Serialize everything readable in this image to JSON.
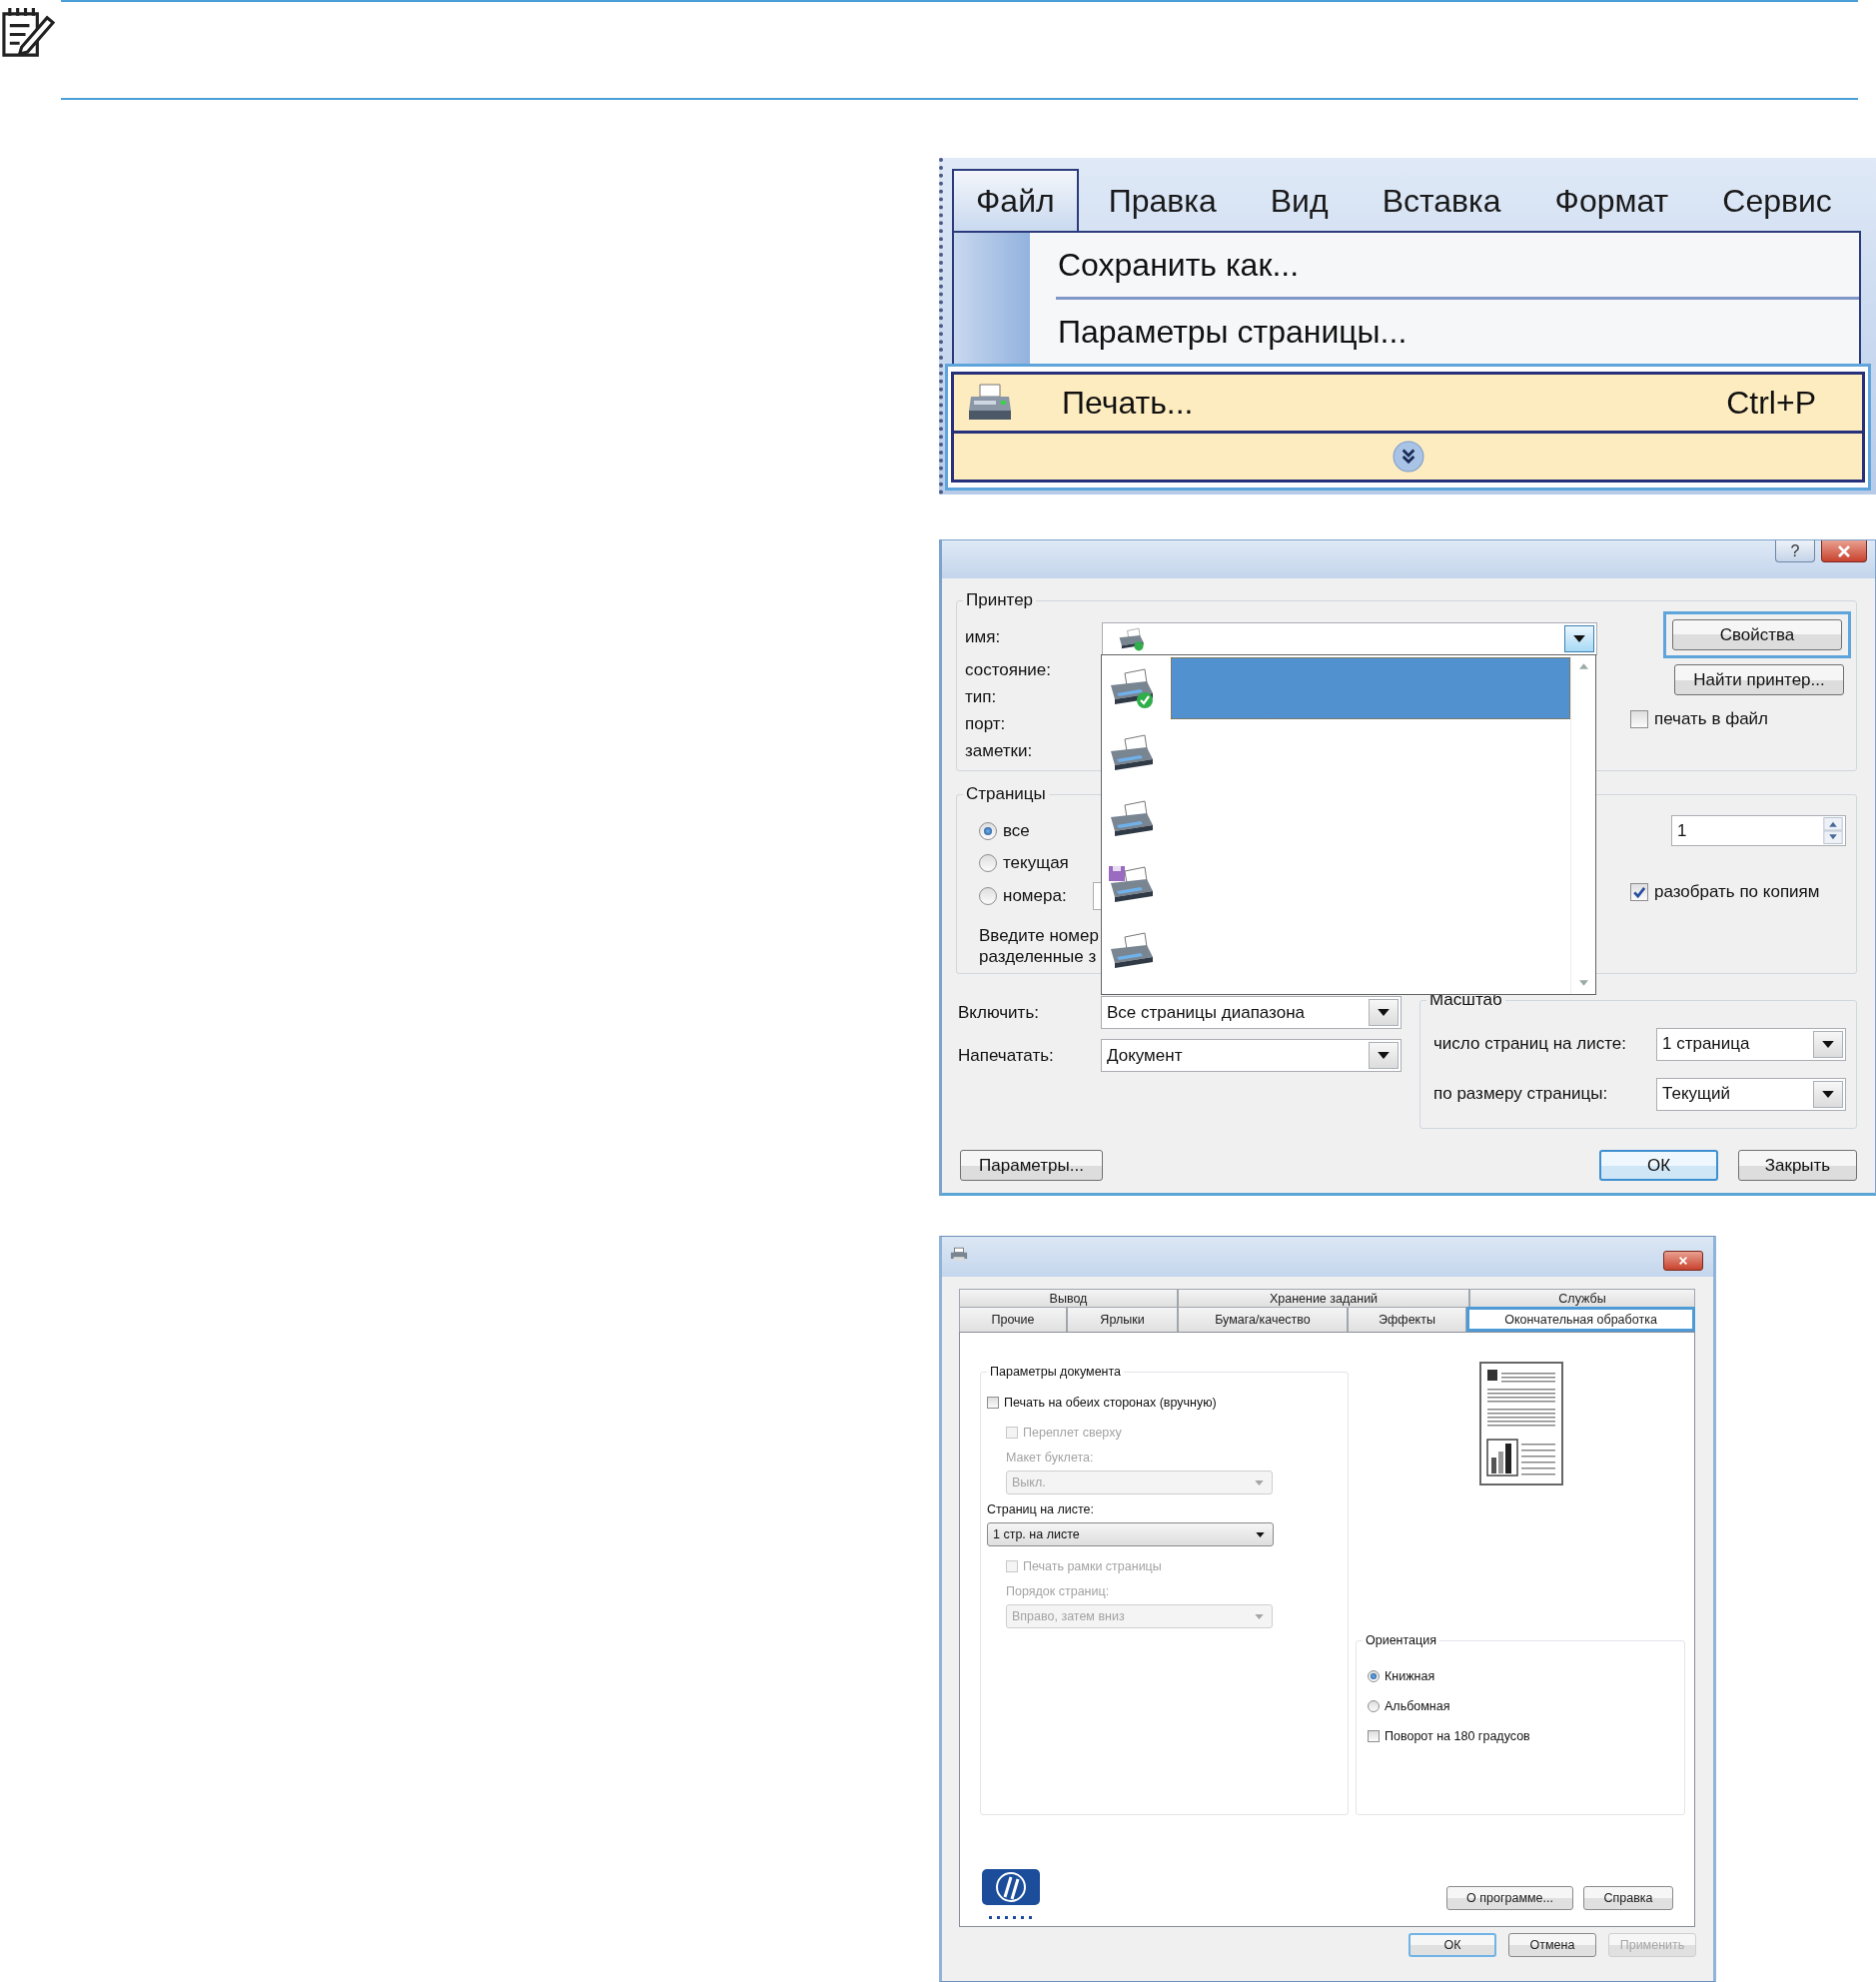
{
  "menu": {
    "menubar": [
      {
        "label": "Файл",
        "selected": true
      },
      {
        "label": "Правка",
        "selected": false
      },
      {
        "label": "Вид",
        "selected": false
      },
      {
        "label": "Вставка",
        "selected": false
      },
      {
        "label": "Формат",
        "selected": false
      },
      {
        "label": "Сервис",
        "selected": false
      }
    ],
    "items": [
      {
        "kind": "command",
        "label": "Сохранить как...",
        "highlighted": false
      },
      {
        "kind": "command",
        "label": "Параметры страницы...",
        "highlighted": false
      },
      {
        "kind": "print",
        "label": "Печать...",
        "shortcut": "Ctrl+P",
        "highlighted": true
      },
      {
        "kind": "expand",
        "highlighted": true
      }
    ]
  },
  "print_dialog": {
    "help_glyph": "?",
    "printer": {
      "title": "Принтер",
      "labels": [
        "имя:",
        "состояние:",
        "тип:",
        "порт:",
        "заметки:"
      ],
      "list": [
        {
          "kind": "default",
          "selected": true
        },
        {
          "kind": "printer",
          "selected": false
        },
        {
          "kind": "printer",
          "selected": false
        },
        {
          "kind": "fax",
          "selected": false
        },
        {
          "kind": "printer",
          "selected": false
        }
      ],
      "properties_button": {
        "label": "Свойства",
        "highlighted": true
      },
      "find_button": "Найти принтер...",
      "print_to_file": {
        "label": "печать в файл",
        "checked": false
      }
    },
    "pages": {
      "title": "Страницы",
      "options": [
        {
          "label": "все",
          "selected": true
        },
        {
          "label": "текущая",
          "selected": false
        },
        {
          "label": "номера:",
          "selected": false
        }
      ],
      "hint": [
        "Введите номер",
        "разделенные з"
      ]
    },
    "copies": {
      "value": "1",
      "collate": {
        "label": "разобрать по копиям",
        "checked": true
      }
    },
    "include": {
      "label": "Включить:",
      "value": "Все страницы диапазона"
    },
    "print_what": {
      "label": "Напечатать:",
      "value": "Документ"
    },
    "scale": {
      "title": "Масштаб",
      "rows": [
        {
          "label": "число страниц на листе:",
          "value": "1 страница"
        },
        {
          "label": "по размеру страницы:",
          "value": "Текущий"
        }
      ]
    },
    "options_button": "Параметры...",
    "ok_button": "ОК",
    "close_button": "Закрыть"
  },
  "properties_dialog": {
    "tab_rows": [
      [
        {
          "label": "Вывод",
          "selected": false
        },
        {
          "label": "Хранение заданий",
          "selected": false
        },
        {
          "label": "Службы",
          "selected": false
        }
      ],
      [
        {
          "label": "Прочие",
          "selected": false
        },
        {
          "label": "Ярлыки",
          "selected": false
        },
        {
          "label": "Бумага/качество",
          "selected": false
        },
        {
          "label": "Эффекты",
          "selected": false
        },
        {
          "label": "Окончательная обработка",
          "selected": true
        }
      ]
    ],
    "doc_group": {
      "title": "Параметры документа",
      "controls": [
        {
          "kind": "checkbox",
          "label": "Печать на обеих сторонах (вручную)",
          "checked": false,
          "disabled": false,
          "children": [
            {
              "kind": "checkbox",
              "label": "Переплет сверху",
              "checked": false,
              "disabled": true
            },
            {
              "kind": "label",
              "label": "Макет буклета:",
              "disabled": true
            },
            {
              "kind": "select",
              "value": "Выкл.",
              "disabled": true
            }
          ]
        },
        {
          "kind": "label",
          "label": "Страниц на листе:",
          "disabled": false
        },
        {
          "kind": "select",
          "value": "1 стр. на листе",
          "disabled": false,
          "children": [
            {
              "kind": "checkbox",
              "label": "Печать рамки страницы",
              "checked": false,
              "disabled": true
            },
            {
              "kind": "label",
              "label": "Порядок страниц:",
              "disabled": true
            },
            {
              "kind": "select",
              "value": "Вправо, затем вниз",
              "disabled": true
            }
          ]
        }
      ]
    },
    "orientation": {
      "title": "Ориентация",
      "controls": [
        {
          "kind": "radio",
          "label": "Книжная",
          "selected": true
        },
        {
          "kind": "radio",
          "label": "Альбомная",
          "selected": false
        },
        {
          "kind": "checkbox",
          "label": "Поворот на 180 градусов",
          "checked": false
        }
      ]
    },
    "about_button": "О программе...",
    "help_button": "Справка",
    "buttons": [
      {
        "label": "ОК",
        "disabled": false
      },
      {
        "label": "Отмена",
        "disabled": false
      },
      {
        "label": "Применить",
        "disabled": true
      }
    ]
  }
}
